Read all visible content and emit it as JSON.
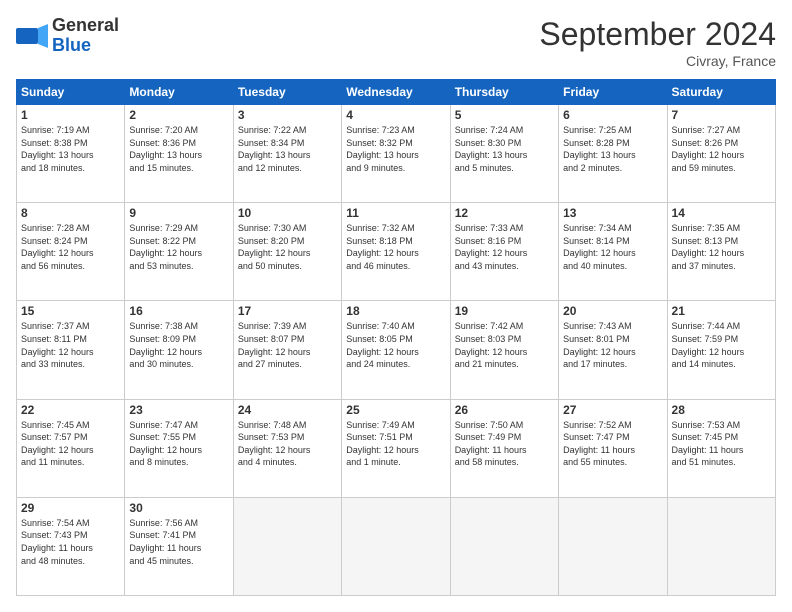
{
  "header": {
    "logo_general": "General",
    "logo_blue": "Blue",
    "month_title": "September 2024",
    "location": "Civray, France"
  },
  "columns": [
    "Sunday",
    "Monday",
    "Tuesday",
    "Wednesday",
    "Thursday",
    "Friday",
    "Saturday"
  ],
  "weeks": [
    [
      {
        "day": "1",
        "info": "Sunrise: 7:19 AM\nSunset: 8:38 PM\nDaylight: 13 hours\nand 18 minutes."
      },
      {
        "day": "2",
        "info": "Sunrise: 7:20 AM\nSunset: 8:36 PM\nDaylight: 13 hours\nand 15 minutes."
      },
      {
        "day": "3",
        "info": "Sunrise: 7:22 AM\nSunset: 8:34 PM\nDaylight: 13 hours\nand 12 minutes."
      },
      {
        "day": "4",
        "info": "Sunrise: 7:23 AM\nSunset: 8:32 PM\nDaylight: 13 hours\nand 9 minutes."
      },
      {
        "day": "5",
        "info": "Sunrise: 7:24 AM\nSunset: 8:30 PM\nDaylight: 13 hours\nand 5 minutes."
      },
      {
        "day": "6",
        "info": "Sunrise: 7:25 AM\nSunset: 8:28 PM\nDaylight: 13 hours\nand 2 minutes."
      },
      {
        "day": "7",
        "info": "Sunrise: 7:27 AM\nSunset: 8:26 PM\nDaylight: 12 hours\nand 59 minutes."
      }
    ],
    [
      {
        "day": "8",
        "info": "Sunrise: 7:28 AM\nSunset: 8:24 PM\nDaylight: 12 hours\nand 56 minutes."
      },
      {
        "day": "9",
        "info": "Sunrise: 7:29 AM\nSunset: 8:22 PM\nDaylight: 12 hours\nand 53 minutes."
      },
      {
        "day": "10",
        "info": "Sunrise: 7:30 AM\nSunset: 8:20 PM\nDaylight: 12 hours\nand 50 minutes."
      },
      {
        "day": "11",
        "info": "Sunrise: 7:32 AM\nSunset: 8:18 PM\nDaylight: 12 hours\nand 46 minutes."
      },
      {
        "day": "12",
        "info": "Sunrise: 7:33 AM\nSunset: 8:16 PM\nDaylight: 12 hours\nand 43 minutes."
      },
      {
        "day": "13",
        "info": "Sunrise: 7:34 AM\nSunset: 8:14 PM\nDaylight: 12 hours\nand 40 minutes."
      },
      {
        "day": "14",
        "info": "Sunrise: 7:35 AM\nSunset: 8:13 PM\nDaylight: 12 hours\nand 37 minutes."
      }
    ],
    [
      {
        "day": "15",
        "info": "Sunrise: 7:37 AM\nSunset: 8:11 PM\nDaylight: 12 hours\nand 33 minutes."
      },
      {
        "day": "16",
        "info": "Sunrise: 7:38 AM\nSunset: 8:09 PM\nDaylight: 12 hours\nand 30 minutes."
      },
      {
        "day": "17",
        "info": "Sunrise: 7:39 AM\nSunset: 8:07 PM\nDaylight: 12 hours\nand 27 minutes."
      },
      {
        "day": "18",
        "info": "Sunrise: 7:40 AM\nSunset: 8:05 PM\nDaylight: 12 hours\nand 24 minutes."
      },
      {
        "day": "19",
        "info": "Sunrise: 7:42 AM\nSunset: 8:03 PM\nDaylight: 12 hours\nand 21 minutes."
      },
      {
        "day": "20",
        "info": "Sunrise: 7:43 AM\nSunset: 8:01 PM\nDaylight: 12 hours\nand 17 minutes."
      },
      {
        "day": "21",
        "info": "Sunrise: 7:44 AM\nSunset: 7:59 PM\nDaylight: 12 hours\nand 14 minutes."
      }
    ],
    [
      {
        "day": "22",
        "info": "Sunrise: 7:45 AM\nSunset: 7:57 PM\nDaylight: 12 hours\nand 11 minutes."
      },
      {
        "day": "23",
        "info": "Sunrise: 7:47 AM\nSunset: 7:55 PM\nDaylight: 12 hours\nand 8 minutes."
      },
      {
        "day": "24",
        "info": "Sunrise: 7:48 AM\nSunset: 7:53 PM\nDaylight: 12 hours\nand 4 minutes."
      },
      {
        "day": "25",
        "info": "Sunrise: 7:49 AM\nSunset: 7:51 PM\nDaylight: 12 hours\nand 1 minute."
      },
      {
        "day": "26",
        "info": "Sunrise: 7:50 AM\nSunset: 7:49 PM\nDaylight: 11 hours\nand 58 minutes."
      },
      {
        "day": "27",
        "info": "Sunrise: 7:52 AM\nSunset: 7:47 PM\nDaylight: 11 hours\nand 55 minutes."
      },
      {
        "day": "28",
        "info": "Sunrise: 7:53 AM\nSunset: 7:45 PM\nDaylight: 11 hours\nand 51 minutes."
      }
    ],
    [
      {
        "day": "29",
        "info": "Sunrise: 7:54 AM\nSunset: 7:43 PM\nDaylight: 11 hours\nand 48 minutes."
      },
      {
        "day": "30",
        "info": "Sunrise: 7:56 AM\nSunset: 7:41 PM\nDaylight: 11 hours\nand 45 minutes."
      },
      {
        "day": "",
        "info": ""
      },
      {
        "day": "",
        "info": ""
      },
      {
        "day": "",
        "info": ""
      },
      {
        "day": "",
        "info": ""
      },
      {
        "day": "",
        "info": ""
      }
    ]
  ]
}
